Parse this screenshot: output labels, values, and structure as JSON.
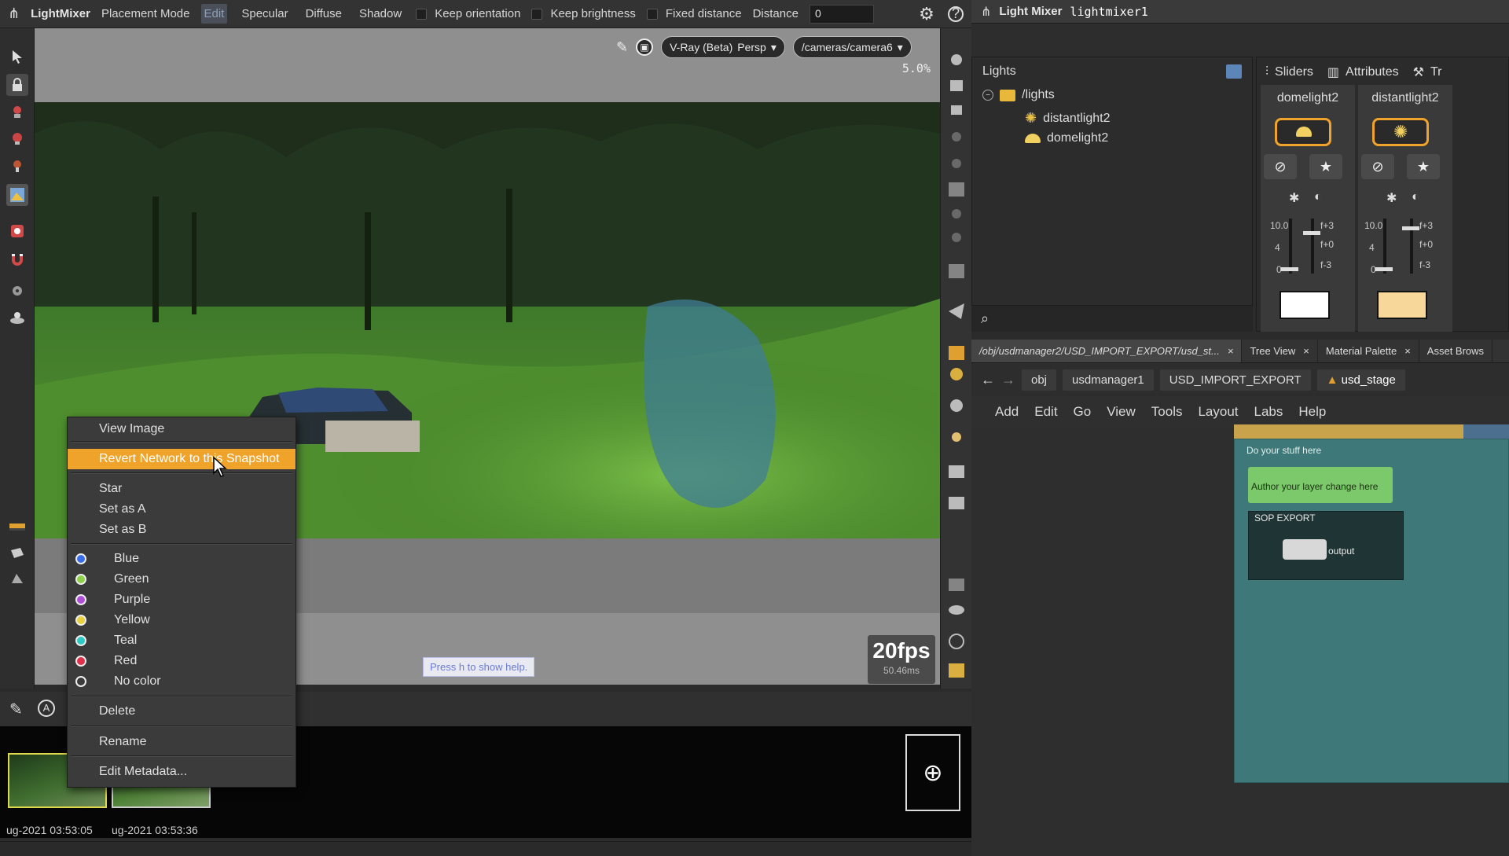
{
  "toolbar": {
    "app_title": "LightMixer",
    "mode": "Placement Mode",
    "buttons": [
      "Edit",
      "Specular",
      "Diffuse",
      "Shadow"
    ],
    "keep_orientation": "Keep orientation",
    "keep_brightness": "Keep brightness",
    "fixed_distance": "Fixed distance",
    "distance_label": "Distance",
    "distance_value": "0"
  },
  "viewport": {
    "renderer": "V-Ray (Beta)",
    "view": "Persp",
    "camera": "/cameras/camera6",
    "zoom": "5.0%",
    "fps": "20fps",
    "frame_time": "50.46ms",
    "help_hint": "Press h to show help."
  },
  "context_menu": {
    "view_image": "View Image",
    "revert": "Revert Network to this Snapshot",
    "star": "Star",
    "set_a": "Set as A",
    "set_b": "Set as B",
    "colors": [
      {
        "label": "Blue",
        "color": "#3a6ee8"
      },
      {
        "label": "Green",
        "color": "#8fd14a"
      },
      {
        "label": "Purple",
        "color": "#b04fd8"
      },
      {
        "label": "Yellow",
        "color": "#e8d040"
      },
      {
        "label": "Teal",
        "color": "#2ec9c2"
      },
      {
        "label": "Red",
        "color": "#e0304a"
      },
      {
        "label": "No color",
        "color": "#3b3b3b"
      }
    ],
    "delete": "Delete",
    "rename": "Rename",
    "edit_metadata": "Edit Metadata..."
  },
  "snapshots": [
    {
      "label": "ug-2021 03:53:05"
    },
    {
      "label": "ug-2021 03:53:36"
    }
  ],
  "light_mixer": {
    "title": "Light Mixer",
    "name": "lightmixer1",
    "lights_header": "Lights",
    "tree": {
      "root": "/lights",
      "children": [
        "distantlight2",
        "domelight2"
      ]
    },
    "tabs": [
      "Sliders",
      "Attributes",
      "Tr"
    ],
    "columns": [
      {
        "name": "domelight2",
        "swatch": "#ffffff",
        "val_max": "10.0",
        "val_mid": "4",
        "val_min": "0",
        "f_hi": "f+3",
        "f_mid": "f+0",
        "f_lo": "f-3"
      },
      {
        "name": "distantlight2",
        "swatch": "#f7d89a",
        "val_max": "10.0",
        "val_mid": "4",
        "val_min": "0",
        "f_hi": "f+3",
        "f_mid": "f+0",
        "f_lo": "f-3"
      }
    ]
  },
  "network": {
    "tabs": [
      "/obj/usdmanager2/USD_IMPORT_EXPORT/usd_st...",
      "Tree View",
      "Material Palette",
      "Asset Brows"
    ],
    "path": [
      "obj",
      "usdmanager1",
      "USD_IMPORT_EXPORT",
      "usd_stage"
    ],
    "menu": [
      "Add",
      "Edit",
      "Go",
      "View",
      "Tools",
      "Layout",
      "Labs",
      "Help"
    ],
    "box_label": "Do your stuff here",
    "sticky_note": "Author your layer change here",
    "sop_title": "SOP EXPORT",
    "node_label": "output"
  }
}
